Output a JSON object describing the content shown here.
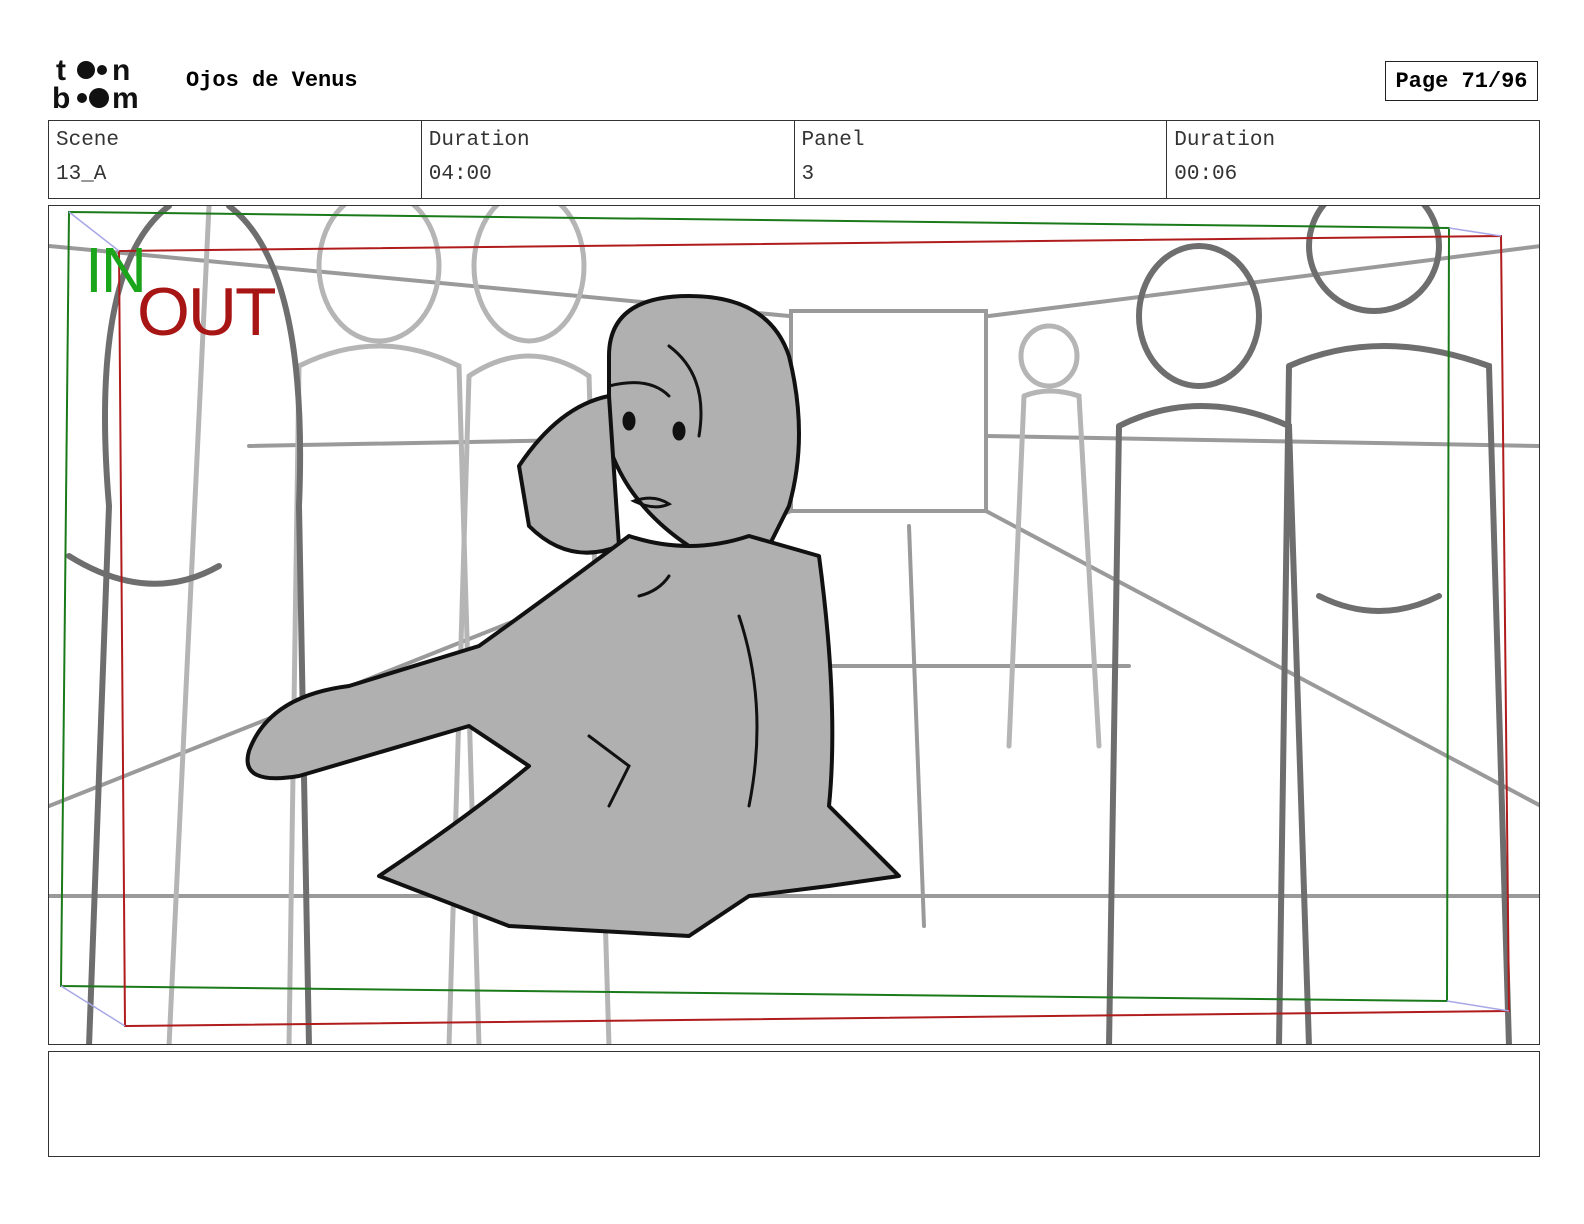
{
  "header": {
    "logo_text": "toon boom",
    "project_title": "Ojos de Venus",
    "page_label": "Page 71/96"
  },
  "info": {
    "scene_label": "Scene",
    "scene_value": "13_A",
    "scene_duration_label": "Duration",
    "scene_duration_value": "04:00",
    "panel_label": "Panel",
    "panel_value": "3",
    "panel_duration_label": "Duration",
    "panel_duration_value": "00:06"
  },
  "panel": {
    "in_label": "IN",
    "out_label": "OUT",
    "in_color": "#1aa51a",
    "out_color": "#a81515"
  },
  "notes": {
    "text": ""
  }
}
